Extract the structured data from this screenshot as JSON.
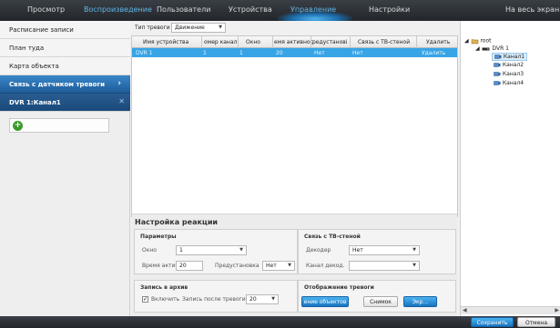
{
  "topnav": {
    "tabs": [
      "Просмотр",
      "Воспроизведение",
      "Пользователи",
      "Устройства",
      "Управление",
      "Настройки"
    ],
    "active": "Управление",
    "fullscreen": "На весь экран"
  },
  "sidebar": {
    "items": [
      "Расписание записи",
      "План туда",
      "Карта объекта",
      "Связь с датчиком тревоги",
      "DVR 1:Канал1"
    ],
    "add_icon": "plus-circle-icon"
  },
  "filter": {
    "label": "Тип тревоги",
    "value": "Движение"
  },
  "table": {
    "columns": [
      "Имя устройства",
      "омер канал",
      "Окно",
      "емя активнос",
      "редустанові",
      "Связь с ТВ-стеной",
      "Удалить"
    ],
    "rows": [
      {
        "device": "DVR 1",
        "channel": "1",
        "window": "1",
        "time": "20",
        "preset": "Нет",
        "wall": "Нет",
        "delete": "Удалить"
      }
    ]
  },
  "reaction": {
    "title": "Настройка реакции",
    "params": {
      "title": "Параметры",
      "window_label": "Окно",
      "window_value": "1",
      "time_label": "Время актив",
      "time_value": "20",
      "preset_label": "Предустановка",
      "preset_value": "Нет"
    },
    "wall": {
      "title": "Связь с ТВ-стеной",
      "decoder_label": "Декодер",
      "decoder_value": "Нет",
      "channel_label": "Канал декод.",
      "channel_value": ""
    },
    "archive": {
      "title": "Запись в архив",
      "enable_label": "Включить",
      "after_label": "Запись после тревоги",
      "after_value": "20"
    },
    "display": {
      "title": "Отображение тревоги",
      "btn_objects": "ение объектов",
      "btn_snapshot": "Снимок",
      "btn_video": "Экр..."
    }
  },
  "tree": {
    "root": "root",
    "dvr": "DVR 1",
    "channels": [
      "Канал1",
      "Канал2",
      "Канал3",
      "Канал4"
    ]
  },
  "bottom": {
    "save": "Сохранить",
    "cancel": "Отмена"
  },
  "colors": {
    "accent": "#37a4e6",
    "nav_bg": "#2b2f35",
    "active_tab": "#5fb6e8"
  }
}
